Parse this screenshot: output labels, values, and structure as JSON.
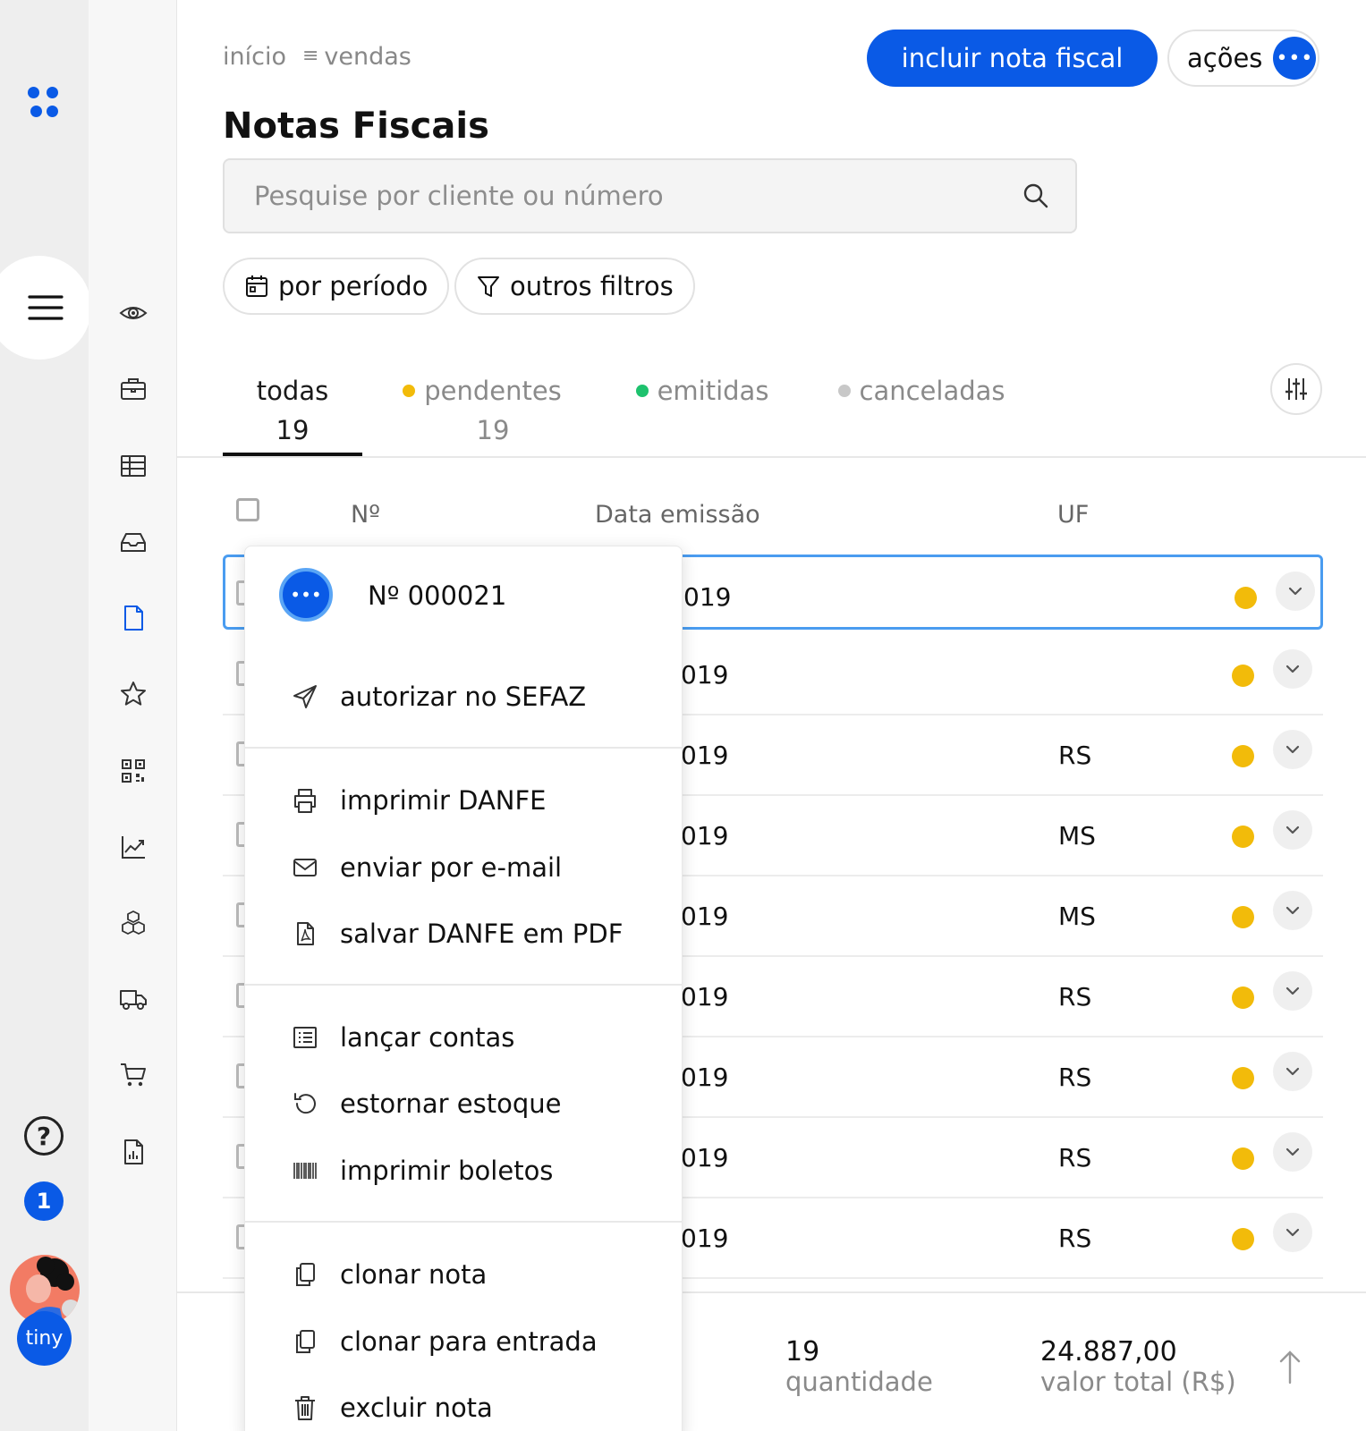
{
  "breadcrumb": {
    "home": "início",
    "section": "vendas"
  },
  "page": {
    "title": "Notas Fiscais"
  },
  "header": {
    "primary_button": "incluir nota fiscal",
    "actions_button": "ações"
  },
  "search": {
    "placeholder": "Pesquise por cliente ou número"
  },
  "filters": {
    "period": "por período",
    "others": "outros filtros"
  },
  "tabs": [
    {
      "label": "todas",
      "count": "19",
      "active": true
    },
    {
      "label": "pendentes",
      "count": "19",
      "dot_color": "#f2bb0a"
    },
    {
      "label": "emitidas",
      "dot_color": "#1ec26e"
    },
    {
      "label": "canceladas",
      "dot_color": "#c8c8c8"
    }
  ],
  "table": {
    "columns": {
      "number": "Nº",
      "date": "Data emissão",
      "uf": "UF"
    },
    "rows": [
      {
        "date": "019",
        "uf": "",
        "status_color": "#f2bb0a"
      },
      {
        "date": "019",
        "uf": "",
        "status_color": "#f2bb0a"
      },
      {
        "date": "019",
        "uf": "RS",
        "status_color": "#f2bb0a"
      },
      {
        "date": "019",
        "uf": "MS",
        "status_color": "#f2bb0a"
      },
      {
        "date": "019",
        "uf": "MS",
        "status_color": "#f2bb0a"
      },
      {
        "date": "019",
        "uf": "RS",
        "status_color": "#f2bb0a"
      },
      {
        "date": "019",
        "uf": "RS",
        "status_color": "#f2bb0a"
      },
      {
        "date": "019",
        "uf": "RS",
        "status_color": "#f2bb0a"
      },
      {
        "date": "019",
        "uf": "RS",
        "status_color": "#f2bb0a"
      }
    ]
  },
  "context_menu": {
    "title": "Nº 000021",
    "items": [
      {
        "label": "autorizar no SEFAZ",
        "icon": "send-icon"
      },
      {
        "label": "imprimir DANFE",
        "icon": "printer-icon"
      },
      {
        "label": "enviar por e-mail",
        "icon": "mail-icon"
      },
      {
        "label": "salvar DANFE em PDF",
        "icon": "pdf-icon"
      },
      {
        "label": "lançar contas",
        "icon": "list-icon"
      },
      {
        "label": "estornar estoque",
        "icon": "undo-icon"
      },
      {
        "label": "imprimir boletos",
        "icon": "barcode-icon"
      },
      {
        "label": "clonar nota",
        "icon": "copy-icon"
      },
      {
        "label": "clonar para entrada",
        "icon": "copy-icon"
      },
      {
        "label": "excluir nota",
        "icon": "trash-icon"
      }
    ]
  },
  "footer": {
    "quantity_value": "19",
    "quantity_label": "quantidade",
    "total_value": "24.887,00",
    "total_label": "valor total (R$)"
  },
  "sidebar": {
    "notifications": "1",
    "brand": "tiny",
    "help": "?"
  },
  "colors": {
    "accent": "#0a5ae6",
    "pending": "#f2bb0a",
    "issued": "#1ec26e",
    "cancelled": "#c8c8c8"
  }
}
